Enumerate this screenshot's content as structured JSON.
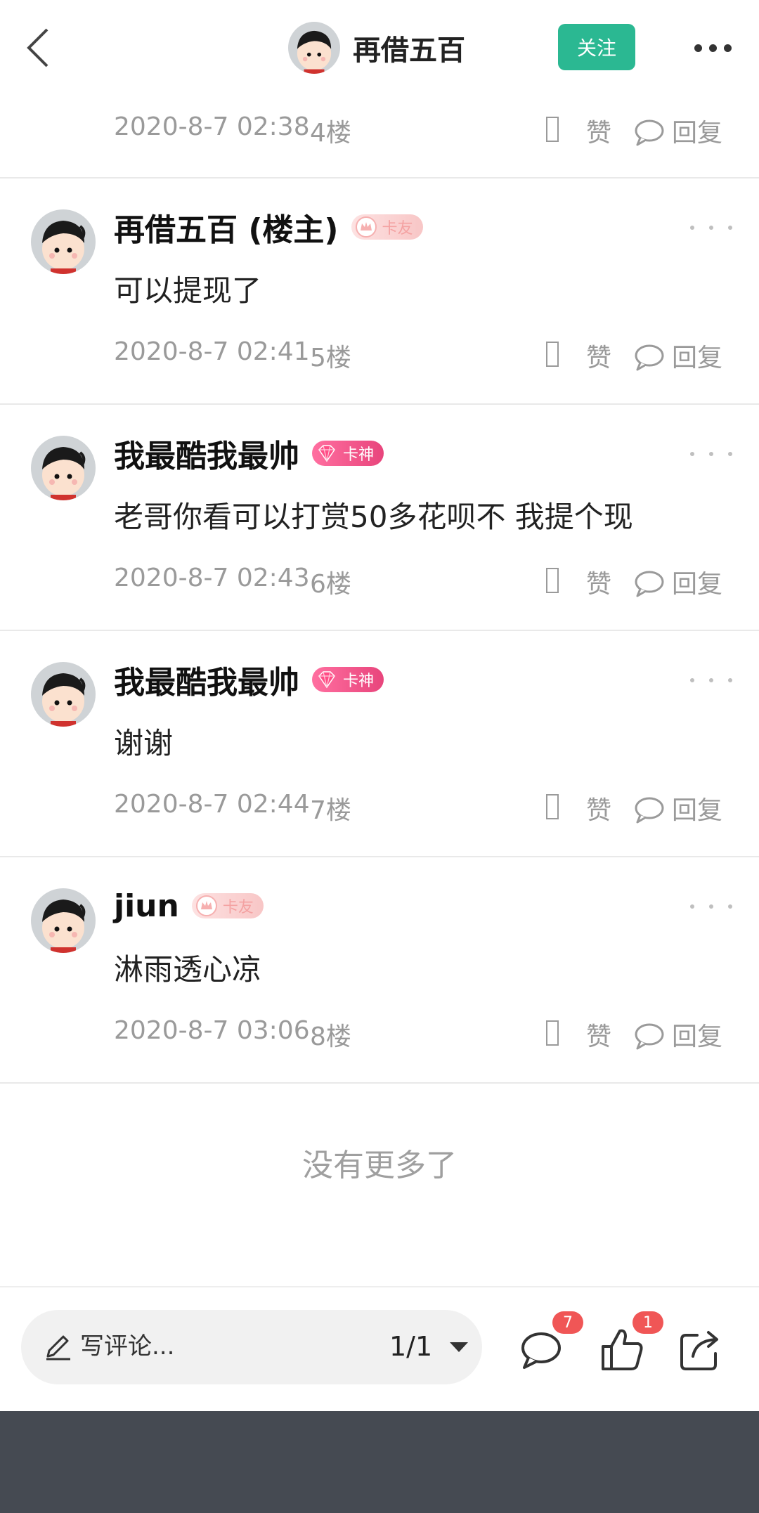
{
  "header": {
    "title": "再借五百",
    "follow_label": "关注"
  },
  "first_meta": {
    "time": "2020-8-7 02:38",
    "floor": "4楼",
    "like_label": "赞",
    "reply_label": "回复"
  },
  "comments": [
    {
      "name": "再借五百 (楼主)",
      "badge": "卡友",
      "text": "可以提现了",
      "time": "2020-8-7 02:41",
      "floor": "5楼",
      "like_label": "赞",
      "reply_label": "回复"
    },
    {
      "name": "我最酷我最帅",
      "badge": "卡神",
      "text": "老哥你看可以打赏50多花呗不 我提个现",
      "time": "2020-8-7 02:43",
      "floor": "6楼",
      "like_label": "赞",
      "reply_label": "回复"
    },
    {
      "name": "我最酷我最帅",
      "badge": "卡神",
      "text": "谢谢",
      "time": "2020-8-7 02:44",
      "floor": "7楼",
      "like_label": "赞",
      "reply_label": "回复"
    },
    {
      "name": "jiun",
      "badge": "卡友",
      "text": "淋雨透心凉",
      "time": "2020-8-7 03:06",
      "floor": "8楼",
      "like_label": "赞",
      "reply_label": "回复"
    }
  ],
  "footer_note": "没有更多了",
  "bottom_bar": {
    "comment_placeholder": "写评论...",
    "page_indicator": "1/1",
    "comment_count": "7",
    "like_count": "1"
  },
  "colors": {
    "accent": "#2bb892",
    "badge_red": "#f05656",
    "god_badge": "#e8457c",
    "system_bar": "#454a52"
  }
}
